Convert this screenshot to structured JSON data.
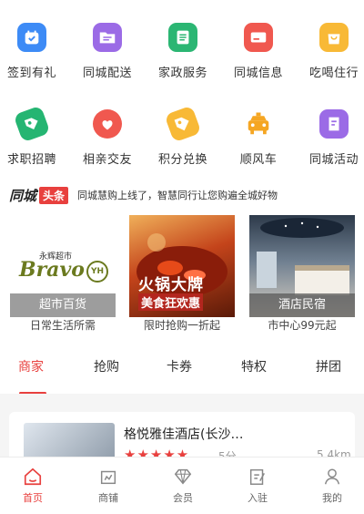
{
  "grid": {
    "row1": [
      {
        "label": "签到有礼",
        "icon": "calendar-check-icon",
        "color": "#3d8bf6"
      },
      {
        "label": "同城配送",
        "icon": "folder-icon",
        "color": "#9b6be6"
      },
      {
        "label": "家政服务",
        "icon": "document-list-icon",
        "color": "#2bb673"
      },
      {
        "label": "同城信息",
        "icon": "card-icon",
        "color": "#f0584f"
      },
      {
        "label": "吃喝住行",
        "icon": "shopping-bag-icon",
        "color": "#f8b936"
      }
    ],
    "row2": [
      {
        "label": "求职招聘",
        "icon": "job-tag-icon",
        "color": "#25b572"
      },
      {
        "label": "相亲交友",
        "icon": "flame-heart-icon",
        "color": "#f0584f"
      },
      {
        "label": "积分兑换",
        "icon": "tag-icon",
        "color": "#f8b936"
      },
      {
        "label": "顺风车",
        "icon": "taxi-icon",
        "color": "#f5a623"
      },
      {
        "label": "同城活动",
        "icon": "note-icon",
        "color": "#9b6be6"
      }
    ]
  },
  "ticker": {
    "brand": "同城",
    "badge": "头条",
    "text": "同城慧购上线了，智慧同行让您购遍全城好物"
  },
  "promos": [
    {
      "caption": "超市百货",
      "subtitle": "日常生活所需",
      "logo_line1": "永辉超市",
      "logo_line2": "Bravo",
      "logo_badge": "YH"
    },
    {
      "caption": "火锅大牌",
      "caption2": "美食狂欢惠",
      "subtitle": "限时抢购一折起"
    },
    {
      "caption": "酒店民宿",
      "subtitle": "市中心99元起"
    }
  ],
  "tabs": [
    "商家",
    "抢购",
    "卡券",
    "特权",
    "拼团"
  ],
  "active_tab": 0,
  "merchant": {
    "name": "格悦雅佳酒店(长沙…",
    "stars": "★★★★★",
    "score": "5分",
    "distance": "5.4km"
  },
  "nav": [
    {
      "label": "首页",
      "icon": "home-icon",
      "active": true
    },
    {
      "label": "商铺",
      "icon": "shop-icon",
      "active": false
    },
    {
      "label": "会员",
      "icon": "diamond-icon",
      "active": false
    },
    {
      "label": "入驻",
      "icon": "edit-icon",
      "active": false
    },
    {
      "label": "我的",
      "icon": "user-icon",
      "active": false
    }
  ],
  "colors": {
    "accent": "#e8403e"
  }
}
